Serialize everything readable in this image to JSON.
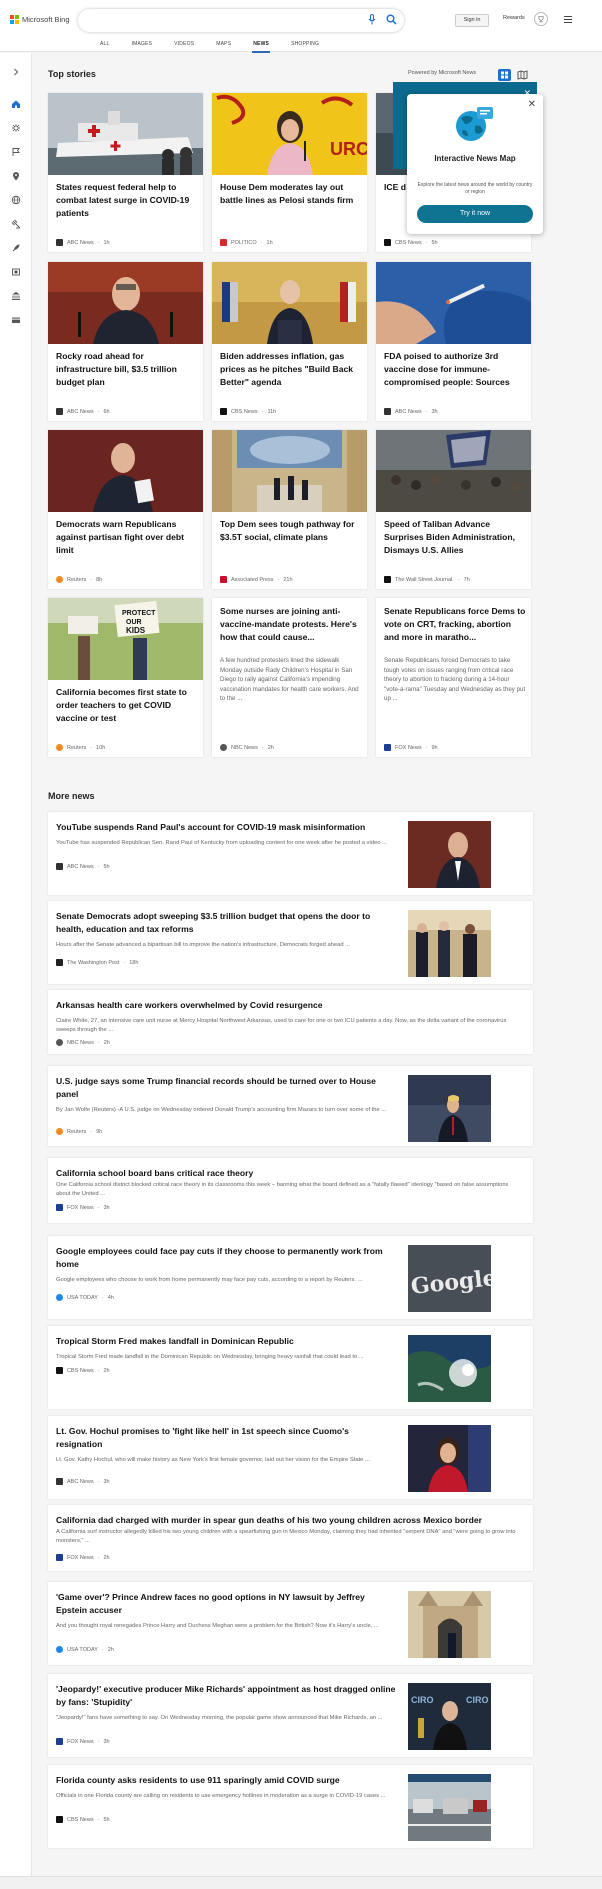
{
  "header": {
    "brand": "Microsoft Bing",
    "search_placeholder": "",
    "signin_label": "Sign in",
    "rewards_label": "Rewards",
    "tabs": [
      "ALL",
      "IMAGES",
      "VIDEOS",
      "MAPS",
      "NEWS",
      "SHOPPING"
    ],
    "active_tab": "NEWS"
  },
  "top_stories": {
    "title": "Top stories",
    "powered_by": "Powered by Microsoft News",
    "cards": [
      {
        "title": "States request federal help to combat latest surge in COVID-19 patients",
        "source": "ABC News",
        "time": "1h",
        "color": "#333"
      },
      {
        "title": "House Dem moderates lay out battle lines as Pelosi stands firm",
        "source": "POLITICO",
        "time": "1h",
        "color": "#d42a2a"
      },
      {
        "title": "ICE d… not to…",
        "source": "CBS News",
        "time": "5h",
        "color": "#111"
      },
      {
        "title": "Rocky road ahead for infrastructure bill, $3.5 trillion budget plan",
        "source": "ABC News",
        "time": "6h",
        "color": "#333"
      },
      {
        "title": "Biden addresses inflation, gas prices as he pitches \"Build Back Better\" agenda",
        "source": "CBS News",
        "time": "11h",
        "color": "#111"
      },
      {
        "title": "FDA poised to authorize 3rd vaccine dose for immune-compromised people: Sources",
        "source": "ABC News",
        "time": "3h",
        "color": "#333"
      },
      {
        "title": "Democrats warn Republicans against partisan fight over debt limit",
        "source": "Reuters",
        "time": "8h",
        "color": "#f08a24"
      },
      {
        "title": "Top Dem sees tough pathway for $3.5T social, climate plans",
        "source": "Associated Press",
        "time": "21h",
        "color": "#c8102e"
      },
      {
        "title": "Speed of Taliban Advance Surprises Biden Administration, Dismays U.S. Allies",
        "source": "The Wall Street Journal.",
        "time": "7h",
        "color": "#111"
      },
      {
        "title": "California becomes first state to order teachers to get COVID vaccine or test",
        "source": "Reuters",
        "time": "10h",
        "color": "#f08a24"
      },
      {
        "title": "Some nurses are joining anti-vaccine-mandate protests. Here's how that could cause...",
        "snippet": "A few hundred protesters lined the sidewalk Monday outside Rady Children's Hospital in San Diego to rally against California's impending vaccination mandates for health care workers. And to the ...",
        "source": "NBC News",
        "time": "2h",
        "color": "#555"
      },
      {
        "title": "Senate Republicans force Dems to vote on CRT, fracking, abortion and more in maratho...",
        "snippet": "Senate Republicans forced Democrats to take tough votes on issues ranging from critical race theory to abortion to fracking during a 14-hour \"vote-a-rama\" Tuesday and Wednesday as they put up ...",
        "source": "FOX News",
        "time": "9h",
        "color": "#1c3f94"
      }
    ]
  },
  "popup": {
    "title": "Interactive News Map",
    "description": "Explore the latest news around the world by country or region",
    "button": "Try it now"
  },
  "more_news": {
    "title": "More news",
    "items": [
      {
        "title": "YouTube suspends Rand Paul's account for COVID-19 mask misinformation",
        "snippet": "YouTube has suspended Republican Sen. Rand Paul of Kentucky from uploading content for one week after he posted a video ...",
        "source": "ABC News",
        "time": "5h",
        "color": "#333"
      },
      {
        "title": "Senate Democrats adopt sweeping $3.5 trillion budget that opens the door to health, education and tax reforms",
        "snippet": "Hours after the Senate advanced a bipartisan bill to improve the nation's infrastructure, Democrats forged ahead ...",
        "source": "The Washington Post",
        "time": "18h",
        "color": "#222"
      },
      {
        "title": "Arkansas health care workers overwhelmed by Covid resurgence",
        "snippet": "Claire White, 27, an intensive care unit nurse at Mercy Hospital Northwest Arkansas, used to care for one or two ICU patients a day. Now, as the delta variant of the coronavirus sweeps through the ...",
        "source": "NBC News",
        "time": "2h",
        "color": "#555"
      },
      {
        "title": "U.S. judge says some Trump financial records should be turned over to House panel",
        "snippet": "By Jan Wolfe (Reuters) -A U.S. judge on Wednesday ordered Donald Trump's accounting firm Mazars to turn over some of the ...",
        "source": "Reuters",
        "time": "9h",
        "color": "#f08a24"
      },
      {
        "title": "California school board bans critical race theory",
        "snippet": "One California school district blocked critical race theory in its classrooms this week – banning what the board defined as a \"fatally flawed\" ideology \"based on false assumptions about the United ...",
        "source": "FOX News",
        "time": "3h",
        "color": "#1c3f94"
      },
      {
        "title": "Google employees could face pay cuts if they choose to permanently work from home",
        "snippet": "Google employees who choose to work from home permanently may face pay cuts, according to a report by Reuters. ...",
        "source": "USA TODAY",
        "time": "4h",
        "color": "#1e88e5"
      },
      {
        "title": "Tropical Storm Fred makes landfall in Dominican Republic",
        "snippet": "Tropical Storm Fred made landfall in the Dominican Republic on Wednesday, bringing heavy rainfall that could lead to ...",
        "source": "CBS News",
        "time": "2h",
        "color": "#111"
      },
      {
        "title": "Lt. Gov. Hochul promises to 'fight like hell' in 1st speech since Cuomo's resignation",
        "snippet": "Lt. Gov. Kathy Hochul, who will make history as New York's first female governor, laid out her vision for the Empire State ...",
        "source": "ABC News",
        "time": "3h",
        "color": "#333"
      },
      {
        "title": "California dad charged with murder in spear gun deaths of his two young children across Mexico border",
        "snippet": "A California surf instructor allegedly killed his two young children with a spearfishing gun in Mexico Monday, claiming they had inherited \"serpent DNA\" and \"were going to grow into monsters,\" ...",
        "source": "FOX News",
        "time": "2h",
        "color": "#1c3f94"
      },
      {
        "title": "'Game over'? Prince Andrew faces no good options in NY lawsuit by Jeffrey Epstein accuser",
        "snippet": "And you thought royal renegades Prince Harry and Duchess Meghan were a problem for the British? Now it's Harry's uncle, ...",
        "source": "USA TODAY",
        "time": "2h",
        "color": "#1e88e5"
      },
      {
        "title": "'Jeopardy!' executive producer Mike Richards' appointment as host dragged online by fans: 'Stupidity'",
        "snippet": "\"Jeopardy!\" fans have something to say. On Wednesday morning, the popular game show announced that Mike Richards, an ...",
        "source": "FOX News",
        "time": "3h",
        "color": "#1c3f94"
      },
      {
        "title": "Florida county asks residents to use 911 sparingly amid COVID surge",
        "snippet": "Officials in one Florida county are calling on residents to use emergency hotlines in moderation as a surge in COVID-19 cases ...",
        "source": "CBS News",
        "time": "5h",
        "color": "#111"
      }
    ]
  }
}
